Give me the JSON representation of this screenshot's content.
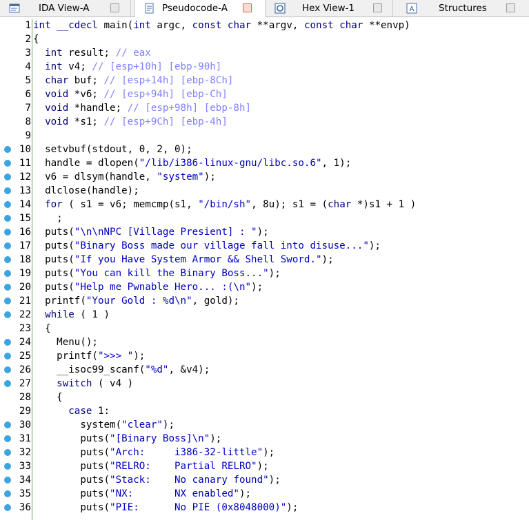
{
  "tabs": [
    {
      "label": "IDA View-A",
      "icon": "disassembly-view-icon",
      "active": false
    },
    {
      "label": "Pseudocode-A",
      "icon": "pseudocode-icon",
      "active": true
    },
    {
      "label": "Hex View-1",
      "icon": "hex-view-icon",
      "active": false
    },
    {
      "label": "Structures",
      "icon": "structures-icon",
      "active": false
    }
  ],
  "colors": {
    "keyword": "#000080",
    "string": "#0000c0",
    "comment": "#8080ff",
    "dot": "#3ea4e0"
  },
  "lines": [
    {
      "n": "1",
      "dot": false,
      "t": "int __cdecl main(int argc, const char **argv, const char **envp)"
    },
    {
      "n": "2",
      "dot": false,
      "t": "{"
    },
    {
      "n": "3",
      "dot": false,
      "t": "  int result; // eax"
    },
    {
      "n": "4",
      "dot": false,
      "t": "  int v4; // [esp+10h] [ebp-90h]"
    },
    {
      "n": "5",
      "dot": false,
      "t": "  char buf; // [esp+14h] [ebp-8Ch]"
    },
    {
      "n": "6",
      "dot": false,
      "t": "  void *v6; // [esp+94h] [ebp-Ch]"
    },
    {
      "n": "7",
      "dot": false,
      "t": "  void *handle; // [esp+98h] [ebp-8h]"
    },
    {
      "n": "8",
      "dot": false,
      "t": "  void *s1; // [esp+9Ch] [ebp-4h]"
    },
    {
      "n": "9",
      "dot": false,
      "t": ""
    },
    {
      "n": "10",
      "dot": true,
      "t": "  setvbuf(stdout, 0, 2, 0);"
    },
    {
      "n": "11",
      "dot": true,
      "t": "  handle = dlopen(\"/lib/i386-linux-gnu/libc.so.6\", 1);"
    },
    {
      "n": "12",
      "dot": true,
      "t": "  v6 = dlsym(handle, \"system\");"
    },
    {
      "n": "13",
      "dot": true,
      "t": "  dlclose(handle);"
    },
    {
      "n": "14",
      "dot": true,
      "t": "  for ( s1 = v6; memcmp(s1, \"/bin/sh\", 8u); s1 = (char *)s1 + 1 )"
    },
    {
      "n": "15",
      "dot": true,
      "t": "    ;"
    },
    {
      "n": "16",
      "dot": true,
      "t": "  puts(\"\\n\\nNPC [Village Presient] : \");"
    },
    {
      "n": "17",
      "dot": true,
      "t": "  puts(\"Binary Boss made our village fall into disuse...\");"
    },
    {
      "n": "18",
      "dot": true,
      "t": "  puts(\"If you Have System Armor && Shell Sword.\");"
    },
    {
      "n": "19",
      "dot": true,
      "t": "  puts(\"You can kill the Binary Boss...\");"
    },
    {
      "n": "20",
      "dot": true,
      "t": "  puts(\"Help me Pwnable Hero... :(\\n\");"
    },
    {
      "n": "21",
      "dot": true,
      "t": "  printf(\"Your Gold : %d\\n\", gold);"
    },
    {
      "n": "22",
      "dot": true,
      "t": "  while ( 1 )"
    },
    {
      "n": "23",
      "dot": false,
      "t": "  {"
    },
    {
      "n": "24",
      "dot": true,
      "t": "    Menu();"
    },
    {
      "n": "25",
      "dot": true,
      "t": "    printf(\">>> \");"
    },
    {
      "n": "26",
      "dot": true,
      "t": "    __isoc99_scanf(\"%d\", &v4);"
    },
    {
      "n": "27",
      "dot": true,
      "t": "    switch ( v4 )"
    },
    {
      "n": "28",
      "dot": false,
      "t": "    {"
    },
    {
      "n": "29",
      "dot": false,
      "t": "      case 1:"
    },
    {
      "n": "30",
      "dot": true,
      "t": "        system(\"clear\");"
    },
    {
      "n": "31",
      "dot": true,
      "t": "        puts(\"[Binary Boss]\\n\");"
    },
    {
      "n": "32",
      "dot": true,
      "t": "        puts(\"Arch:     i386-32-little\");"
    },
    {
      "n": "33",
      "dot": true,
      "t": "        puts(\"RELRO:    Partial RELRO\");"
    },
    {
      "n": "34",
      "dot": true,
      "t": "        puts(\"Stack:    No canary found\");"
    },
    {
      "n": "35",
      "dot": true,
      "t": "        puts(\"NX:       NX enabled\");"
    },
    {
      "n": "36",
      "dot": true,
      "t": "        puts(\"PIE:      No PIE (0x8048000)\");"
    }
  ]
}
